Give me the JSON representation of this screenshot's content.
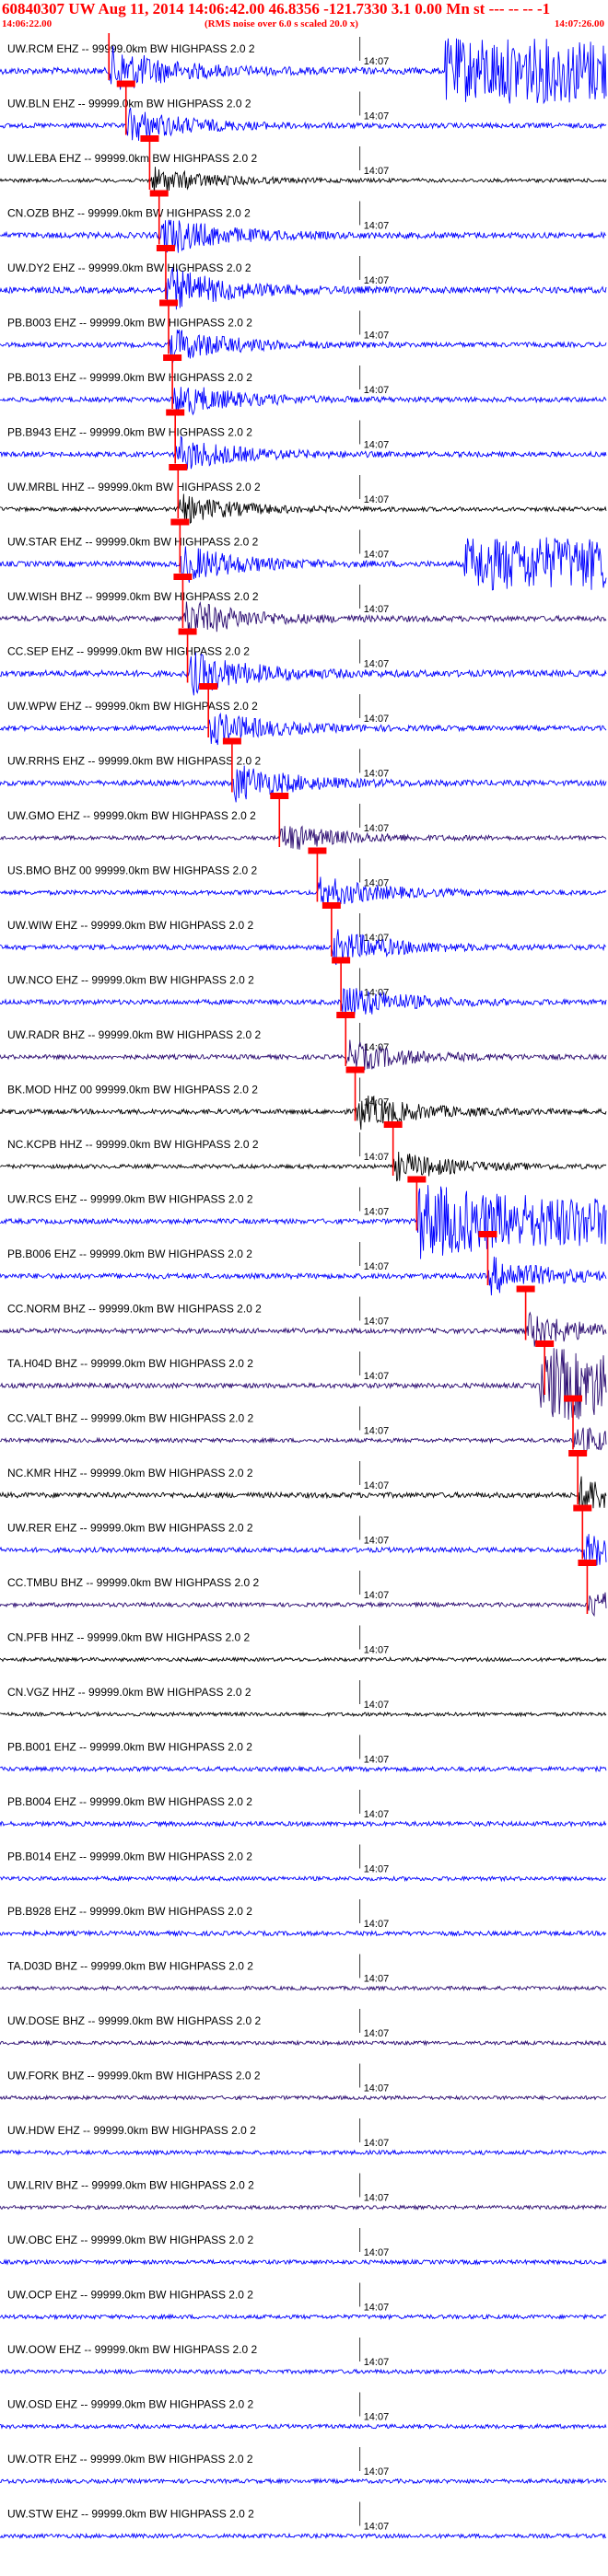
{
  "header": {
    "title": "60840307 UW Aug 11, 2014 14:06:42.00   46.8356 -121.7330  3.1 0.00 Mn st --- -- --  -1",
    "start_time": "14:06:22.00",
    "note": "(RMS noise over 6.0 s scaled 20.0 x)",
    "end_time": "14:07:26.00"
  },
  "colors": {
    "accent": "#ff0000",
    "seismo_blue": "#0000ff",
    "seismo_black": "#000000",
    "seismo_purple": "#2a0a70"
  },
  "chart_data": {
    "type": "line",
    "title": "60840307 UW Aug 11, 2014 14:06:42.00",
    "x_start": "14:06:22.00",
    "x_end": "14:07:26.00",
    "minute_tick": "14:07",
    "x_unit": "seconds after 14:06:22.00",
    "xlim": [
      0,
      64
    ],
    "traces": [
      {
        "label": "UW.RCM EHZ -- 99999.0km BW  HIGHPASS  2.0  2",
        "color": "blue",
        "pick": 11.5,
        "amp": 1.6,
        "burst": [
          47,
          64
        ]
      },
      {
        "label": "UW.BLN EHZ -- 99999.0km BW  HIGHPASS  2.0  2",
        "color": "blue",
        "pick": 13.3,
        "amp": 1.2,
        "burst": null
      },
      {
        "label": "UW.LEBA EHZ -- 99999.0km BW  HIGHPASS  2.0  2",
        "color": "black",
        "pick": 15.8,
        "amp": 0.9,
        "burst": null
      },
      {
        "label": "CN.OZB BHZ -- 99999.0km BW  HIGHPASS  2.0  2",
        "color": "blue",
        "pick": 16.8,
        "amp": 1.4,
        "burst": null
      },
      {
        "label": "UW.DY2 EHZ -- 99999.0km BW  HIGHPASS  2.0  2",
        "color": "blue",
        "pick": 17.5,
        "amp": 1.5,
        "burst": null
      },
      {
        "label": "PB.B003 EHZ -- 99999.0km BW  HIGHPASS  2.0  2",
        "color": "blue",
        "pick": 17.8,
        "amp": 1.2,
        "burst": null
      },
      {
        "label": "PB.B013 EHZ -- 99999.0km BW  HIGHPASS  2.0  2",
        "color": "blue",
        "pick": 18.2,
        "amp": 1.2,
        "burst": null
      },
      {
        "label": "PB.B943 EHZ -- 99999.0km BW  HIGHPASS  2.0  2",
        "color": "blue",
        "pick": 18.5,
        "amp": 1.2,
        "burst": null
      },
      {
        "label": "UW.MRBL HHZ -- 99999.0km BW  HIGHPASS  2.0  2",
        "color": "black",
        "pick": 18.8,
        "amp": 1.0,
        "burst": null
      },
      {
        "label": "UW.STAR EHZ -- 99999.0km BW  HIGHPASS  2.0  2",
        "color": "blue",
        "pick": 19.0,
        "amp": 1.3,
        "burst": [
          49,
          64
        ]
      },
      {
        "label": "UW.WISH BHZ -- 99999.0km BW  HIGHPASS  2.0  2",
        "color": "purple",
        "pick": 19.3,
        "amp": 1.3,
        "burst": null
      },
      {
        "label": "CC.SEP EHZ -- 99999.0km BW  HIGHPASS  2.0  2",
        "color": "blue",
        "pick": 19.8,
        "amp": 1.5,
        "burst": null
      },
      {
        "label": "UW.WPW EHZ -- 99999.0km BW  HIGHPASS  2.0  2",
        "color": "blue",
        "pick": 22.0,
        "amp": 1.2,
        "burst": null
      },
      {
        "label": "UW.RRHS EHZ -- 99999.0km BW  HIGHPASS  2.0  2",
        "color": "blue",
        "pick": 24.5,
        "amp": 1.3,
        "burst": null
      },
      {
        "label": "UW.GMO EHZ -- 99999.0km BW  HIGHPASS  2.0  2",
        "color": "purple",
        "pick": 29.5,
        "amp": 1.0,
        "burst": null
      },
      {
        "label": "US.BMO BHZ 00 99999.0km BW  HIGHPASS  2.0  2",
        "color": "blue",
        "pick": 33.5,
        "amp": 1.1,
        "burst": null
      },
      {
        "label": "UW.WIW EHZ -- 99999.0km BW  HIGHPASS  2.0  2",
        "color": "blue",
        "pick": 35.0,
        "amp": 1.2,
        "burst": null
      },
      {
        "label": "UW.NCO EHZ -- 99999.0km BW  HIGHPASS  2.0  2",
        "color": "blue",
        "pick": 36.0,
        "amp": 1.2,
        "burst": null
      },
      {
        "label": "UW.RADR BHZ -- 99999.0km BW  HIGHPASS  2.0  2",
        "color": "purple",
        "pick": 36.5,
        "amp": 1.1,
        "burst": null
      },
      {
        "label": "BK.MOD HHZ 00 99999.0km BW  HIGHPASS  2.0  2",
        "color": "black",
        "pick": 37.5,
        "amp": 1.2,
        "burst": null
      },
      {
        "label": "NC.KCPB HHZ -- 99999.0km BW  HIGHPASS  2.0  2",
        "color": "black",
        "pick": 41.5,
        "amp": 1.0,
        "burst": null
      },
      {
        "label": "UW.RCS EHZ -- 99999.0km BW  HIGHPASS  2.0  2",
        "color": "blue",
        "pick": 44.0,
        "amp": 1.2,
        "burst": [
          44,
          64
        ]
      },
      {
        "label": "PB.B006 EHZ -- 99999.0km BW  HIGHPASS  2.0  2",
        "color": "blue",
        "pick": 51.5,
        "amp": 1.3,
        "burst": null
      },
      {
        "label": "CC.NORM BHZ -- 99999.0km BW  HIGHPASS  2.0  2",
        "color": "purple",
        "pick": 55.5,
        "amp": 1.2,
        "burst": null
      },
      {
        "label": "TA.H04D BHZ -- 99999.0km BW  HIGHPASS  2.0  2",
        "color": "purple",
        "pick": 57.5,
        "amp": 1.2,
        "burst": [
          57,
          64
        ]
      },
      {
        "label": "CC.VALT BHZ -- 99999.0km BW  HIGHPASS  2.0  2",
        "color": "purple",
        "pick": 60.5,
        "amp": 1.0,
        "burst": null
      },
      {
        "label": "NC.KMR HHZ -- 99999.0km BW  HIGHPASS  2.0  2",
        "color": "black",
        "pick": 61.0,
        "amp": 1.3,
        "burst": null
      },
      {
        "label": "UW.RER EHZ -- 99999.0km BW  HIGHPASS  2.0  2",
        "color": "blue",
        "pick": 61.5,
        "amp": 1.2,
        "burst": null
      },
      {
        "label": "CC.TMBU BHZ -- 99999.0km BW  HIGHPASS  2.0  2",
        "color": "purple",
        "pick": 62.0,
        "amp": 1.0,
        "burst": null
      },
      {
        "label": "CN.PFB HHZ -- 99999.0km BW  HIGHPASS  2.0  2",
        "color": "black",
        "pick": null,
        "amp": 0.9,
        "burst": null
      },
      {
        "label": "CN.VGZ HHZ -- 99999.0km BW  HIGHPASS  2.0  2",
        "color": "black",
        "pick": null,
        "amp": 0.9,
        "burst": null
      },
      {
        "label": "PB.B001 EHZ -- 99999.0km BW  HIGHPASS  2.0  2",
        "color": "blue",
        "pick": null,
        "amp": 1.1,
        "burst": null
      },
      {
        "label": "PB.B004 EHZ -- 99999.0km BW  HIGHPASS  2.0  2",
        "color": "blue",
        "pick": null,
        "amp": 1.1,
        "burst": null
      },
      {
        "label": "PB.B014 EHZ -- 99999.0km BW  HIGHPASS  2.0  2",
        "color": "blue",
        "pick": null,
        "amp": 1.0,
        "burst": null
      },
      {
        "label": "PB.B928 EHZ -- 99999.0km BW  HIGHPASS  2.0  2",
        "color": "blue",
        "pick": null,
        "amp": 1.1,
        "burst": null
      },
      {
        "label": "TA.D03D BHZ -- 99999.0km BW  HIGHPASS  2.0  2",
        "color": "purple",
        "pick": null,
        "amp": 0.9,
        "burst": null
      },
      {
        "label": "UW.DOSE BHZ -- 99999.0km BW  HIGHPASS  2.0  2",
        "color": "purple",
        "pick": null,
        "amp": 0.9,
        "burst": null
      },
      {
        "label": "UW.FORK BHZ -- 99999.0km BW  HIGHPASS  2.0  2",
        "color": "purple",
        "pick": null,
        "amp": 0.9,
        "burst": null
      },
      {
        "label": "UW.HDW EHZ -- 99999.0km BW  HIGHPASS  2.0  2",
        "color": "blue",
        "pick": null,
        "amp": 1.0,
        "burst": null
      },
      {
        "label": "UW.LRIV BHZ -- 99999.0km BW  HIGHPASS  2.0  2",
        "color": "purple",
        "pick": null,
        "amp": 0.9,
        "burst": null
      },
      {
        "label": "UW.OBC EHZ -- 99999.0km BW  HIGHPASS  2.0  2",
        "color": "blue",
        "pick": null,
        "amp": 1.0,
        "burst": null
      },
      {
        "label": "UW.OCP EHZ -- 99999.0km BW  HIGHPASS  2.0  2",
        "color": "blue",
        "pick": null,
        "amp": 1.0,
        "burst": null
      },
      {
        "label": "UW.OOW EHZ -- 99999.0km BW  HIGHPASS  2.0  2",
        "color": "blue",
        "pick": null,
        "amp": 1.0,
        "burst": null
      },
      {
        "label": "UW.OSD EHZ -- 99999.0km BW  HIGHPASS  2.0  2",
        "color": "blue",
        "pick": null,
        "amp": 1.0,
        "burst": null
      },
      {
        "label": "UW.OTR EHZ -- 99999.0km BW  HIGHPASS  2.0  2",
        "color": "blue",
        "pick": null,
        "amp": 1.0,
        "burst": null
      },
      {
        "label": "UW.STW EHZ -- 99999.0km BW  HIGHPASS  2.0  2",
        "color": "blue",
        "pick": null,
        "amp": 1.0,
        "burst": null
      }
    ]
  }
}
